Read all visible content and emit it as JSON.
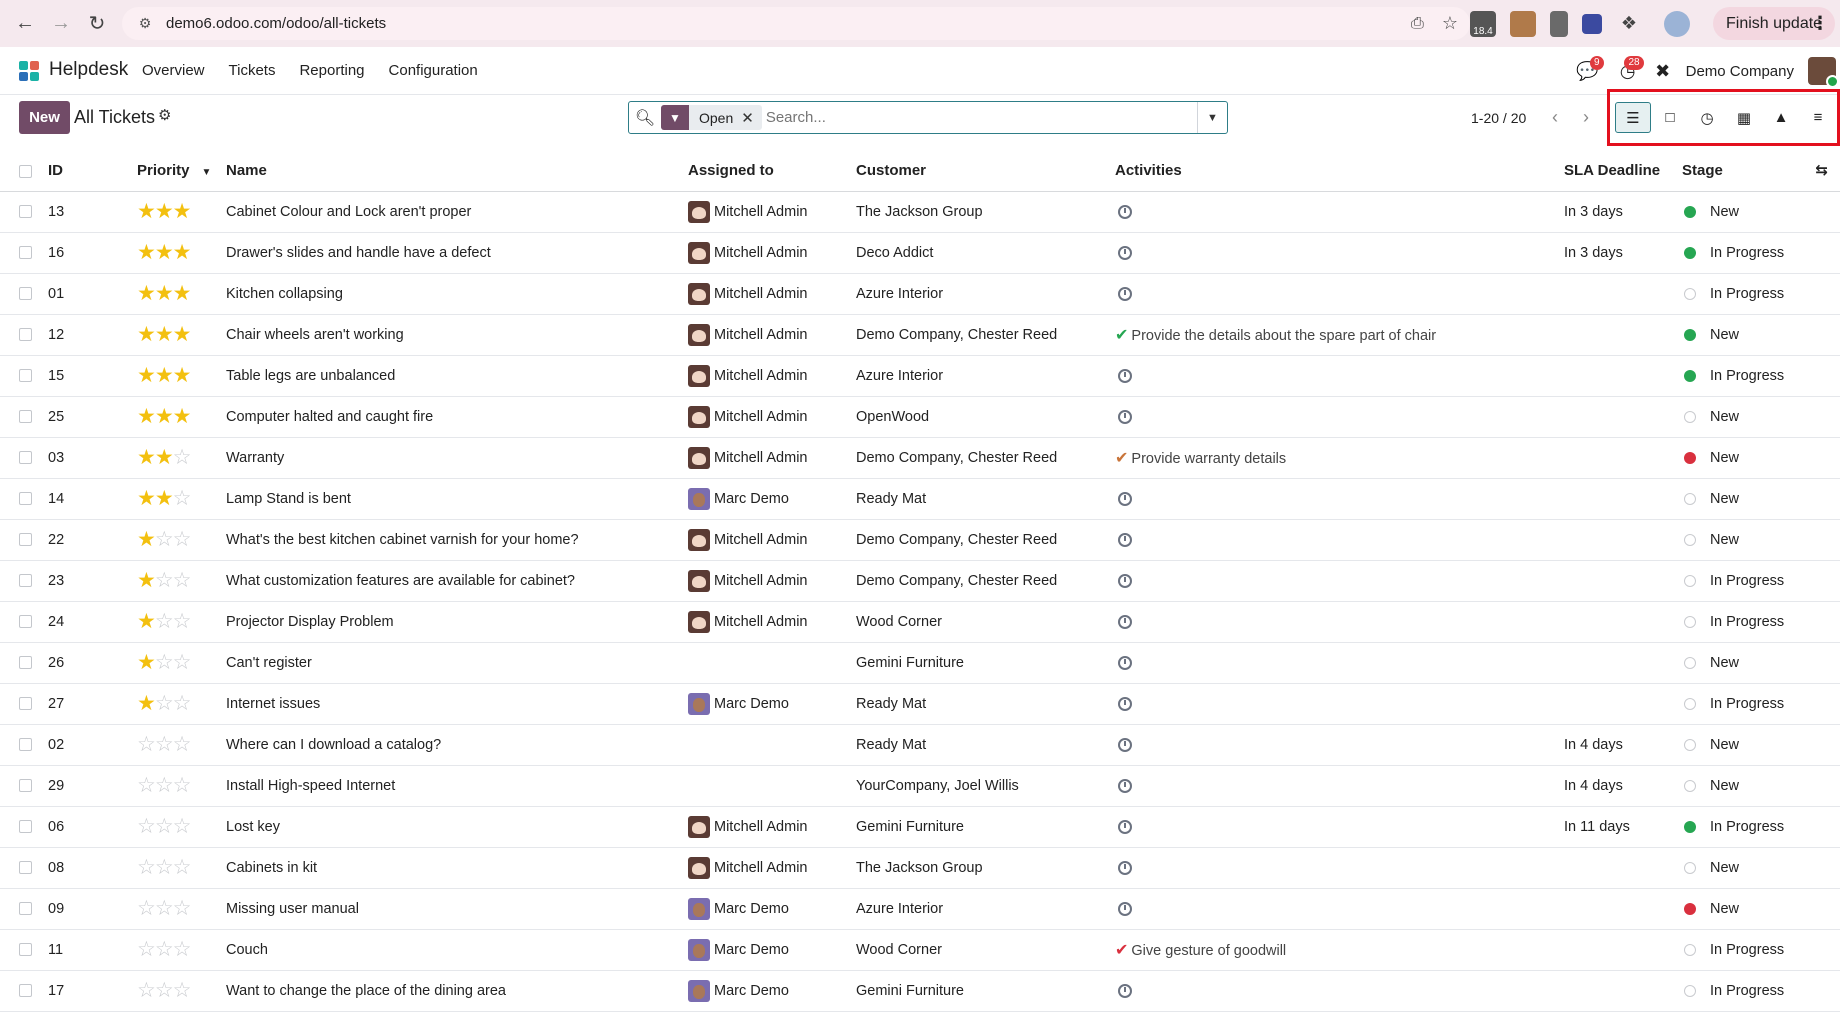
{
  "browser": {
    "url": "demo6.odoo.com/odoo/all-tickets",
    "ext_label": "18.4",
    "finish_update": "Finish update"
  },
  "navbar": {
    "app_name": "Helpdesk",
    "menu": [
      "Overview",
      "Tickets",
      "Reporting",
      "Configuration"
    ],
    "messages_count": "9",
    "activities_count": "28",
    "company": "Demo Company"
  },
  "control": {
    "new_label": "New",
    "title": "All Tickets",
    "facet": "Open",
    "search_placeholder": "Search...",
    "pager": "1-20 / 20"
  },
  "columns": [
    "ID",
    "Priority",
    "Name",
    "Assigned to",
    "Customer",
    "Activities",
    "SLA Deadline",
    "Stage"
  ],
  "colors": {
    "accent": "#714b67",
    "teal": "#2e7d87",
    "star": "#f3c00f",
    "highlight": "#e3101e"
  },
  "tickets": [
    {
      "id": "13",
      "stars": 3,
      "name": "Cabinet Colour and Lock aren't proper",
      "assignee": "Mitchell Admin",
      "av": "m",
      "customer": "The Jackson Group",
      "activity": "",
      "act_color": "",
      "sla": "In 3 days",
      "status": "green",
      "stage": "New"
    },
    {
      "id": "16",
      "stars": 3,
      "name": "Drawer's slides and handle have a defect",
      "assignee": "Mitchell Admin",
      "av": "m",
      "customer": "Deco Addict",
      "activity": "",
      "act_color": "",
      "sla": "In 3 days",
      "status": "green",
      "stage": "In Progress"
    },
    {
      "id": "01",
      "stars": 3,
      "name": "Kitchen collapsing",
      "assignee": "Mitchell Admin",
      "av": "m",
      "customer": "Azure Interior",
      "activity": "",
      "act_color": "",
      "sla": "",
      "status": "grey",
      "stage": "In Progress"
    },
    {
      "id": "12",
      "stars": 3,
      "name": "Chair wheels aren't working",
      "assignee": "Mitchell Admin",
      "av": "m",
      "customer": "Demo Company, Chester Reed",
      "activity": "Provide the details about the spare part of chair",
      "act_color": "#26a652",
      "sla": "",
      "status": "green",
      "stage": "New"
    },
    {
      "id": "15",
      "stars": 3,
      "name": "Table legs are unbalanced",
      "assignee": "Mitchell Admin",
      "av": "m",
      "customer": "Azure Interior",
      "activity": "",
      "act_color": "",
      "sla": "",
      "status": "green",
      "stage": "In Progress"
    },
    {
      "id": "25",
      "stars": 3,
      "name": "Computer halted and caught fire",
      "assignee": "Mitchell Admin",
      "av": "m",
      "customer": "OpenWood",
      "activity": "",
      "act_color": "",
      "sla": "",
      "status": "grey",
      "stage": "New"
    },
    {
      "id": "03",
      "stars": 2,
      "name": "Warranty",
      "assignee": "Mitchell Admin",
      "av": "m",
      "customer": "Demo Company, Chester Reed",
      "activity": "Provide warranty details",
      "act_color": "#c9753a",
      "sla": "",
      "status": "red",
      "stage": "New"
    },
    {
      "id": "14",
      "stars": 2,
      "name": "Lamp Stand is bent",
      "assignee": "Marc Demo",
      "av": "d",
      "customer": "Ready Mat",
      "activity": "",
      "act_color": "",
      "sla": "",
      "status": "grey",
      "stage": "New"
    },
    {
      "id": "22",
      "stars": 1,
      "name": "What's the best kitchen cabinet varnish for your home?",
      "assignee": "Mitchell Admin",
      "av": "m",
      "customer": "Demo Company, Chester Reed",
      "activity": "",
      "act_color": "",
      "sla": "",
      "status": "grey",
      "stage": "New"
    },
    {
      "id": "23",
      "stars": 1,
      "name": "What customization features are available for cabinet?",
      "assignee": "Mitchell Admin",
      "av": "m",
      "customer": "Demo Company, Chester Reed",
      "activity": "",
      "act_color": "",
      "sla": "",
      "status": "grey",
      "stage": "In Progress"
    },
    {
      "id": "24",
      "stars": 1,
      "name": "Projector Display Problem",
      "assignee": "Mitchell Admin",
      "av": "m",
      "customer": "Wood Corner",
      "activity": "",
      "act_color": "",
      "sla": "",
      "status": "grey",
      "stage": "In Progress"
    },
    {
      "id": "26",
      "stars": 1,
      "name": "Can't register",
      "assignee": "",
      "av": "",
      "customer": "Gemini Furniture",
      "activity": "",
      "act_color": "",
      "sla": "",
      "status": "grey",
      "stage": "New"
    },
    {
      "id": "27",
      "stars": 1,
      "name": "Internet issues",
      "assignee": "Marc Demo",
      "av": "d",
      "customer": "Ready Mat",
      "activity": "",
      "act_color": "",
      "sla": "",
      "status": "grey",
      "stage": "In Progress"
    },
    {
      "id": "02",
      "stars": 0,
      "name": "Where can I download a catalog?",
      "assignee": "",
      "av": "",
      "customer": "Ready Mat",
      "activity": "",
      "act_color": "",
      "sla": "In 4 days",
      "status": "grey",
      "stage": "New"
    },
    {
      "id": "29",
      "stars": 0,
      "name": "Install High-speed Internet",
      "assignee": "",
      "av": "",
      "customer": "YourCompany, Joel Willis",
      "activity": "",
      "act_color": "",
      "sla": "In 4 days",
      "status": "grey",
      "stage": "New"
    },
    {
      "id": "06",
      "stars": 0,
      "name": "Lost key",
      "assignee": "Mitchell Admin",
      "av": "m",
      "customer": "Gemini Furniture",
      "activity": "",
      "act_color": "",
      "sla": "In 11 days",
      "status": "green",
      "stage": "In Progress"
    },
    {
      "id": "08",
      "stars": 0,
      "name": "Cabinets in kit",
      "assignee": "Mitchell Admin",
      "av": "m",
      "customer": "The Jackson Group",
      "activity": "",
      "act_color": "",
      "sla": "",
      "status": "grey",
      "stage": "New"
    },
    {
      "id": "09",
      "stars": 0,
      "name": "Missing user manual",
      "assignee": "Marc Demo",
      "av": "d",
      "customer": "Azure Interior",
      "activity": "",
      "act_color": "",
      "sla": "",
      "status": "red",
      "stage": "New"
    },
    {
      "id": "11",
      "stars": 0,
      "name": "Couch",
      "assignee": "Marc Demo",
      "av": "d",
      "customer": "Wood Corner",
      "activity": "Give gesture of goodwill",
      "act_color": "#d9303e",
      "sla": "",
      "status": "grey",
      "stage": "In Progress"
    },
    {
      "id": "17",
      "stars": 0,
      "name": "Want to change the place of the dining area",
      "assignee": "Marc Demo",
      "av": "d",
      "customer": "Gemini Furniture",
      "activity": "",
      "act_color": "",
      "sla": "",
      "status": "grey",
      "stage": "In Progress"
    }
  ]
}
